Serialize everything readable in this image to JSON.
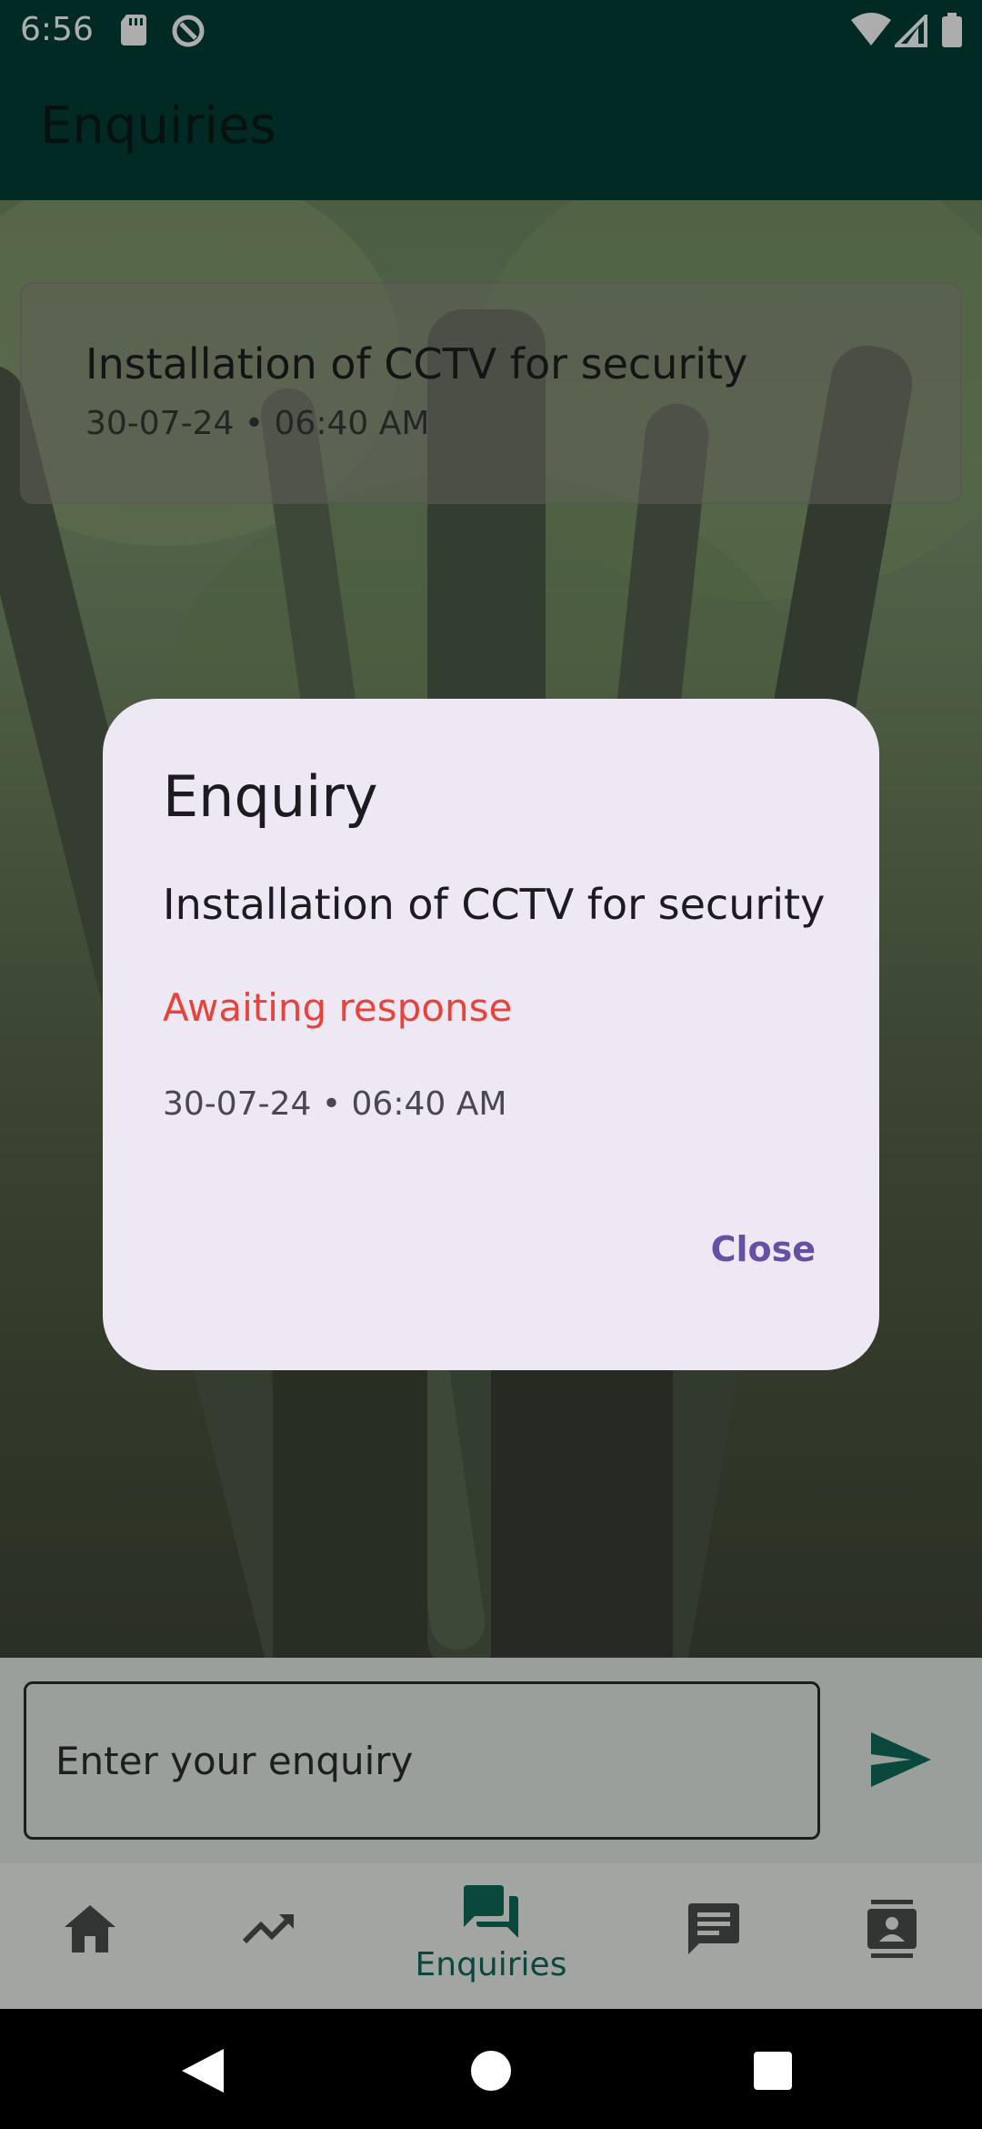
{
  "status_bar": {
    "time": "6:56",
    "icons": [
      "sd-card-icon",
      "data-saver-icon",
      "wifi-icon",
      "cell-signal-icon",
      "battery-icon"
    ]
  },
  "app_bar": {
    "title": "Enquiries"
  },
  "enquiry_list": [
    {
      "title": "Installation of CCTV for security",
      "meta": "30-07-24 • 06:40 AM"
    }
  ],
  "input": {
    "placeholder": "Enter your enquiry",
    "value": ""
  },
  "send_button": {
    "icon": "send-icon"
  },
  "bottom_nav": {
    "items": [
      {
        "icon": "home-icon",
        "label": ""
      },
      {
        "icon": "trending-up-icon",
        "label": ""
      },
      {
        "icon": "forum-icon",
        "label": "Enquiries",
        "selected": true
      },
      {
        "icon": "message-list-icon",
        "label": ""
      },
      {
        "icon": "contact-card-icon",
        "label": ""
      }
    ]
  },
  "dialog": {
    "title": "Enquiry",
    "message": "Installation of CCTV for security",
    "status": "Awaiting response",
    "time": "30-07-24 • 06:40 AM",
    "close_label": "Close"
  },
  "colors": {
    "app_bar": "#023f36",
    "accent": "#0f6b5a",
    "status_text": "#e8433a",
    "dialog_button": "#6650a4",
    "dialog_bg": "#eee8f4"
  }
}
